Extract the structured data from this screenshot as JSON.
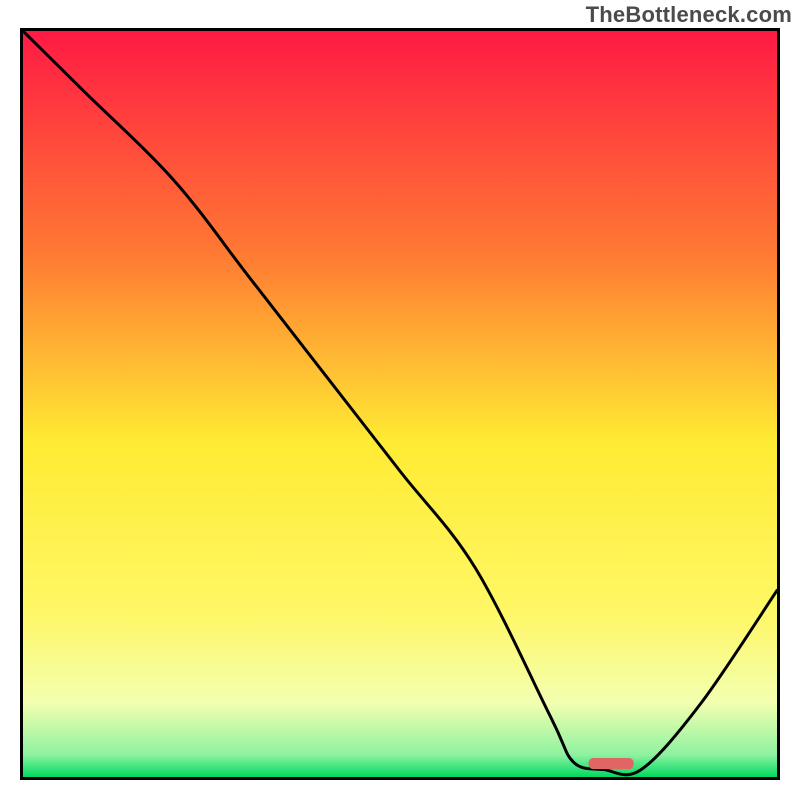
{
  "attribution": "TheBottleneck.com",
  "chart_data": {
    "type": "line",
    "title": "",
    "xlabel": "",
    "ylabel": "",
    "xlim": [
      0,
      100
    ],
    "ylim": [
      0,
      100
    ],
    "grid": false,
    "legend": false,
    "series": [
      {
        "name": "curve",
        "x": [
          0,
          8,
          20,
          30,
          40,
          50,
          60,
          70,
          73,
          77,
          82,
          90,
          100
        ],
        "y": [
          100,
          92,
          80,
          67,
          54,
          41,
          28,
          8,
          2,
          1,
          1,
          10,
          25
        ]
      }
    ],
    "marker": {
      "name": "optimal-range",
      "x_center": 78,
      "y": 1.8,
      "width_pct_x": 6,
      "height_pct_y": 1.5,
      "color": "#e06666"
    },
    "colors": {
      "gradient_top": "#ff1a44",
      "gradient_mid_upper": "#ff9933",
      "gradient_mid": "#ffeb33",
      "gradient_mid_lower": "#f7ff8a",
      "gradient_bottom": "#00d95f",
      "curve": "#000000",
      "border": "#000000"
    }
  }
}
